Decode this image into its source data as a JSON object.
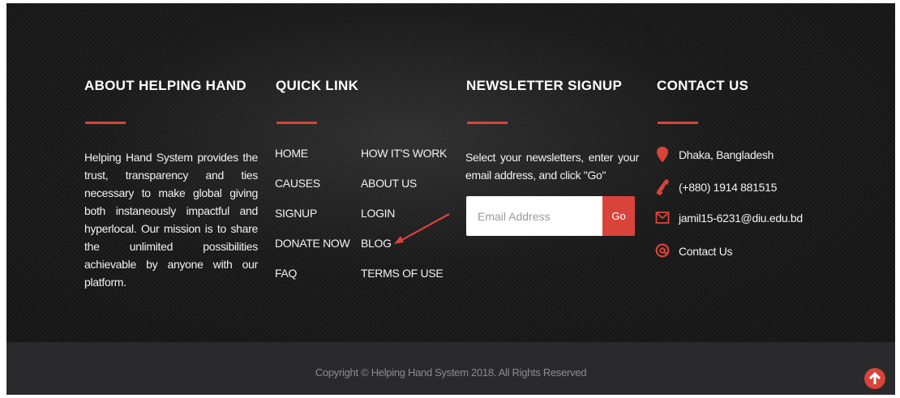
{
  "about": {
    "heading": "ABOUT HELPING HAND",
    "text": "Helping Hand System provides the trust, transparency and ties necessary to make global giving both instaneously impactful and hyperlocal. Our mission is to share the unlimited possibilities achievable by anyone with our platform."
  },
  "quick_link": {
    "heading": "QUICK LINK",
    "col1": [
      "HOME",
      "CAUSES",
      "SIGNUP",
      "DONATE NOW",
      "FAQ"
    ],
    "col2": [
      "HOW IT'S WORK",
      "ABOUT US",
      "LOGIN",
      "BLOG",
      "TERMS OF USE"
    ]
  },
  "newsletter": {
    "heading": "NEWSLETTER SIGNUP",
    "text": "Select your newsletters, enter your email address, and click \"Go\"",
    "email_placeholder": "Email Address",
    "go_label": "Go"
  },
  "contact": {
    "heading": "CONTACT US",
    "address": "Dhaka, Bangladesh",
    "phone": "(+880) 1914 881515",
    "email": "jamil15-6231@diu.edu.bd",
    "contact_link": "Contact Us"
  },
  "footer": {
    "copyright": "Copyright © Helping Hand System 2018. All Rights Reserved"
  },
  "icons": {
    "address": "map-marker-icon",
    "phone": "phone-icon",
    "email": "envelope-icon",
    "contact": "at-sign-icon",
    "scroll_top": "arrow-up-icon"
  },
  "colors": {
    "accent": "#d9443a",
    "footer_bg": "#151515",
    "bottom_bar_bg": "#2a2a2c"
  }
}
